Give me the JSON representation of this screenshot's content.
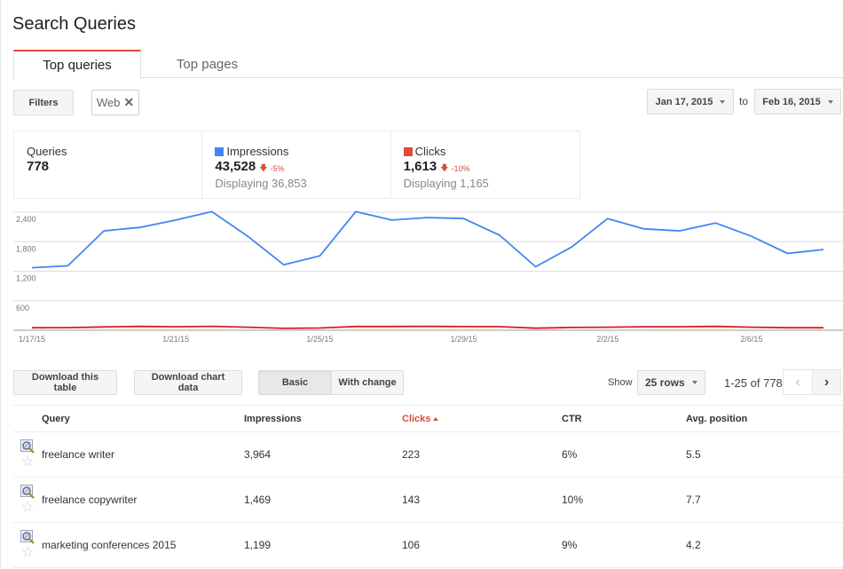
{
  "page": {
    "title": "Search Queries"
  },
  "tabs": [
    {
      "label": "Top queries",
      "active": true
    },
    {
      "label": "Top pages",
      "active": false
    }
  ],
  "filters": {
    "button_label": "Filters",
    "chip_label": "Web",
    "chip_remove_icon": "close-icon"
  },
  "date_range": {
    "from": "Jan 17, 2015",
    "to_label": "to",
    "to": "Feb 16, 2015"
  },
  "scorecards": [
    {
      "label": "Queries",
      "value": "778"
    },
    {
      "label": "Impressions",
      "value": "43,528",
      "delta": "-5%",
      "sub": "Displaying 36,853",
      "color": "#4285f4"
    },
    {
      "label": "Clicks",
      "value": "1,613",
      "delta": "-10%",
      "sub": "Displaying 1,165",
      "color": "#dd4b39"
    }
  ],
  "chart_data": {
    "type": "line",
    "title": "",
    "xlabel": "",
    "ylabel": "",
    "ylim": [
      0,
      2400
    ],
    "yticks": [
      600,
      1200,
      1800,
      2400
    ],
    "ytick_labels": [
      "600",
      "1,200",
      "1,800",
      "2,400"
    ],
    "grid": true,
    "x": [
      "1/17/15",
      "1/18/15",
      "1/19/15",
      "1/20/15",
      "1/21/15",
      "1/22/15",
      "1/23/15",
      "1/24/15",
      "1/25/15",
      "1/26/15",
      "1/27/15",
      "1/28/15",
      "1/29/15",
      "1/30/15",
      "1/31/15",
      "2/1/15",
      "2/2/15",
      "2/3/15",
      "2/4/15",
      "2/5/15",
      "2/6/15",
      "2/7/15",
      "2/8/15"
    ],
    "xtick_labels": [
      "1/17/15",
      "1/21/15",
      "1/25/15",
      "1/29/15",
      "2/2/15",
      "2/6/15"
    ],
    "series": [
      {
        "name": "Impressions",
        "color": "#4285f4",
        "values": [
          1270,
          1310,
          2020,
          2090,
          2240,
          2410,
          1910,
          1330,
          1510,
          2410,
          2240,
          2290,
          2270,
          1930,
          1290,
          1690,
          2270,
          2060,
          2020,
          2180,
          1910,
          1560,
          1640
        ]
      },
      {
        "name": "Clicks",
        "color": "#dd1c1c",
        "values": [
          50,
          52,
          66,
          78,
          70,
          80,
          62,
          38,
          45,
          76,
          76,
          78,
          74,
          72,
          42,
          56,
          62,
          70,
          70,
          78,
          62,
          50,
          50
        ]
      }
    ]
  },
  "table_toolbar": {
    "download_table": "Download this table",
    "download_chart": "Download chart data",
    "view_basic": "Basic",
    "view_change": "With change",
    "show_label": "Show",
    "rows_selected": "25 rows",
    "range": "1-25 of 778",
    "prev_icon": "‹",
    "next_icon": "›"
  },
  "table": {
    "columns": [
      "Query",
      "Impressions",
      "Clicks",
      "CTR",
      "Avg. position"
    ],
    "sorted_column": "Clicks",
    "rows": [
      {
        "query": "freelance writer",
        "impressions": "3,964",
        "clicks": "223",
        "ctr": "6%",
        "position": "5.5"
      },
      {
        "query": "freelance copywriter",
        "impressions": "1,469",
        "clicks": "143",
        "ctr": "10%",
        "position": "7.7"
      },
      {
        "query": "marketing conferences 2015",
        "impressions": "1,199",
        "clicks": "106",
        "ctr": "9%",
        "position": "4.2"
      }
    ]
  }
}
